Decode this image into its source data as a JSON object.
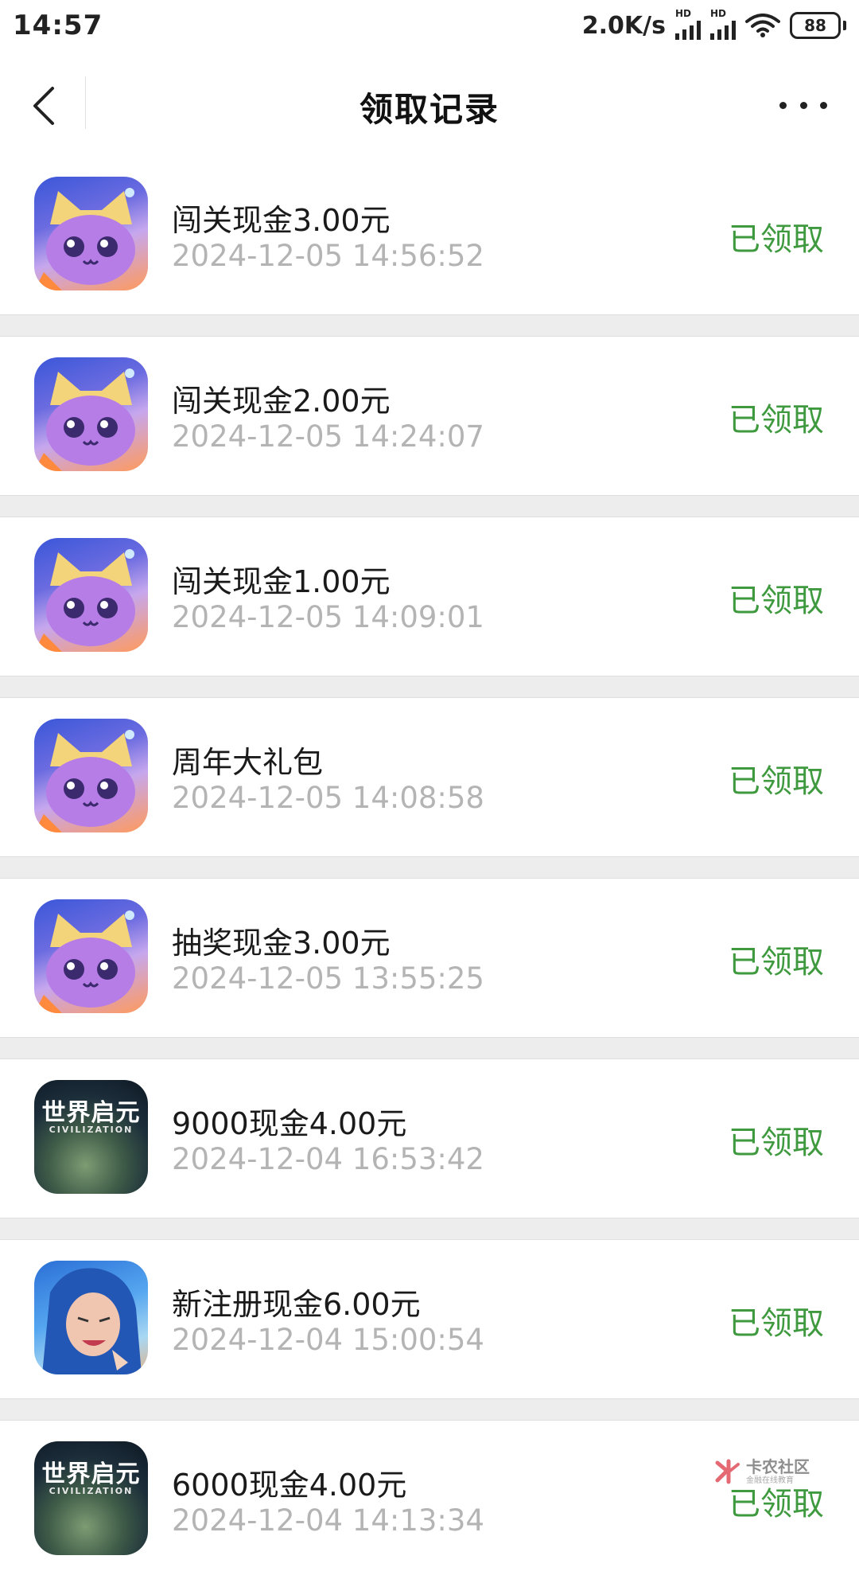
{
  "status_bar": {
    "time": "14:57",
    "net_speed": "2.0K/s",
    "signal_1_tag": "HD",
    "signal_2_tag": "HD",
    "battery": "88"
  },
  "header": {
    "title": "领取记录"
  },
  "records": [
    {
      "title": "闯关现金3.00元",
      "time": "2024-12-05 14:56:52",
      "status": "已领取",
      "icon": "cat-game-icon"
    },
    {
      "title": "闯关现金2.00元",
      "time": "2024-12-05 14:24:07",
      "status": "已领取",
      "icon": "cat-game-icon"
    },
    {
      "title": "闯关现金1.00元",
      "time": "2024-12-05 14:09:01",
      "status": "已领取",
      "icon": "cat-game-icon"
    },
    {
      "title": "周年大礼包",
      "time": "2024-12-05 14:08:58",
      "status": "已领取",
      "icon": "cat-game-icon"
    },
    {
      "title": "抽奖现金3.00元",
      "time": "2024-12-05 13:55:25",
      "status": "已领取",
      "icon": "cat-game-icon"
    },
    {
      "title": "9000现金4.00元",
      "time": "2024-12-04 16:53:42",
      "status": "已领取",
      "icon": "civilization-game-icon",
      "icon_title": "世界启元",
      "icon_subtitle": "CIVILIZATION"
    },
    {
      "title": "新注册现金6.00元",
      "time": "2024-12-04 15:00:54",
      "status": "已领取",
      "icon": "hero-game-icon"
    },
    {
      "title": "6000现金4.00元",
      "time": "2024-12-04 14:13:34",
      "status": "已领取",
      "icon": "civilization-game-icon",
      "icon_title": "世界启元",
      "icon_subtitle": "CIVILIZATION"
    }
  ],
  "watermark": {
    "name": "卡农社区",
    "tagline": "金融在线教育"
  },
  "colors": {
    "status_green": "#3f9a3f",
    "time_gray": "#b4b4b4",
    "divider_gray": "#ededed"
  }
}
